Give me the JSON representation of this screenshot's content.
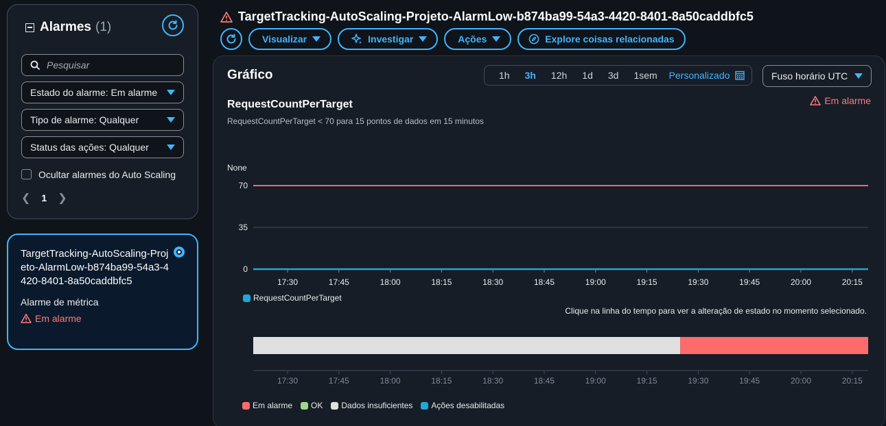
{
  "left_panel": {
    "title": "Alarmes",
    "count": "(1)",
    "search_placeholder": "Pesquisar",
    "filters": [
      "Estado do alarme: Em alarme",
      "Tipo de alarme: Qualquer",
      "Status das ações: Qualquer"
    ],
    "hide_autoscaling_label": "Ocultar alarmes do Auto Scaling",
    "page": "1"
  },
  "alarm_card": {
    "name": "TargetTracking-AutoScaling-Projeto-AlarmLow-b874ba99-54a3-4420-8401-8a50caddbfc5",
    "kind": "Alarme de métrica",
    "state": "Em alarme"
  },
  "header": {
    "title": "TargetTracking-AutoScaling-Projeto-AlarmLow-b874ba99-54a3-4420-8401-8a50caddbfc5",
    "buttons": [
      "Visualizar",
      "Investigar",
      "Ações",
      "Explore coisas relacionadas"
    ]
  },
  "graph": {
    "title": "Gráfico",
    "ranges": [
      "1h",
      "3h",
      "12h",
      "1d",
      "3d",
      "1sem"
    ],
    "active_range": "3h",
    "custom_label": "Personalizado",
    "timezone": "Fuso horário UTC",
    "metric_title": "RequestCountPerTarget",
    "metric_desc": "RequestCountPerTarget < 70 para 15 pontos de dados em 15 minutos",
    "state": "Em alarme",
    "timeline_hint": "Clique na linha do tempo para ver a alteração de estado no momento selecionado.",
    "state_legend": [
      {
        "label": "Em alarme",
        "color": "#ff6b6b"
      },
      {
        "label": "OK",
        "color": "#9bd88c"
      },
      {
        "label": "Dados insuficientes",
        "color": "#e0e0e0"
      },
      {
        "label": "Ações desabilitadas",
        "color": "#1fa7d6"
      }
    ]
  },
  "chart_data": {
    "type": "line",
    "ylabel": "None",
    "yticks": [
      0,
      35,
      70
    ],
    "ylim": [
      0,
      70
    ],
    "x": [
      "17:30",
      "17:45",
      "18:00",
      "18:15",
      "18:30",
      "18:45",
      "19:00",
      "19:15",
      "19:30",
      "19:45",
      "20:00",
      "20:15"
    ],
    "series": [
      {
        "name": "RequestCountPerTarget",
        "color": "#1fa7d6",
        "values": [
          0,
          0,
          0,
          0,
          0,
          0,
          0,
          0,
          0,
          0,
          0,
          0
        ]
      }
    ],
    "threshold": {
      "value": 70,
      "color": "#ff6b6b"
    },
    "state_timeline": [
      {
        "state": "Dados insuficientes",
        "from": "17:20",
        "to": "19:25"
      },
      {
        "state": "Em alarme",
        "from": "19:25",
        "to": "20:20"
      }
    ]
  },
  "colors": {
    "accent": "#42b4ff",
    "alarm": "#ff7a7a",
    "background": "#0f141a"
  }
}
